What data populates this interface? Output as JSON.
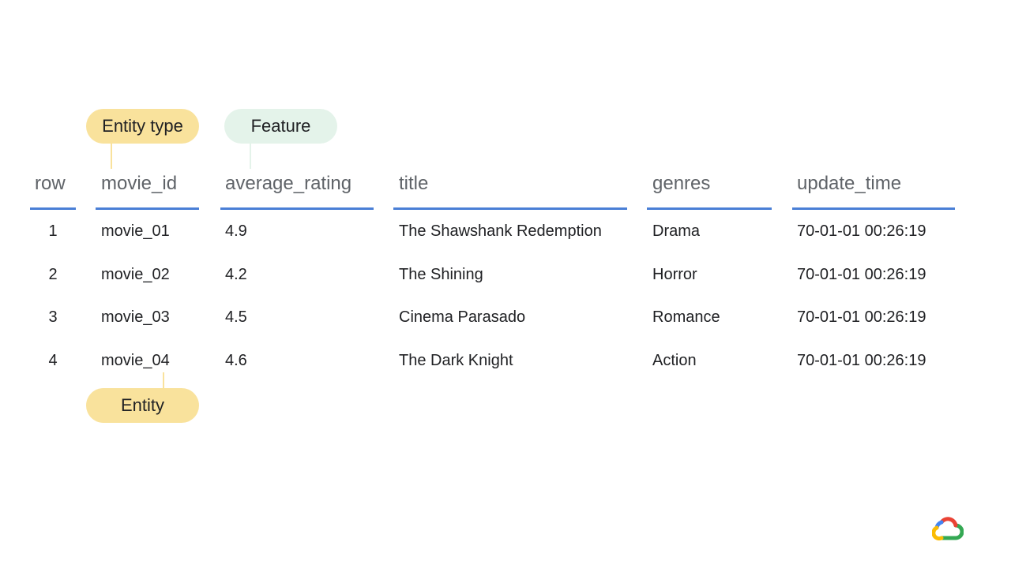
{
  "annotations": {
    "entity_type_label": "Entity type",
    "feature_label": "Feature",
    "entity_label": "Entity"
  },
  "table": {
    "columns": [
      "row",
      "movie_id",
      "average_rating",
      "title",
      "genres",
      "update_time"
    ],
    "rows": [
      [
        "1",
        "movie_01",
        "4.9",
        "The Shawshank Redemption",
        "Drama",
        "70-01-01 00:26:19"
      ],
      [
        "2",
        "movie_02",
        "4.2",
        "The Shining",
        "Horror",
        "70-01-01 00:26:19"
      ],
      [
        "3",
        "movie_03",
        "4.5",
        "Cinema Parasado",
        "Romance",
        "70-01-01 00:26:19"
      ],
      [
        "4",
        "movie_04",
        "4.6",
        "The Dark Knight",
        "Action",
        "70-01-01 00:26:19"
      ]
    ]
  },
  "colors": {
    "entity_pill": "#f9e29c",
    "feature_pill": "#e4f3ea",
    "header_rule": "#4a7fd6",
    "header_text": "#5f6368",
    "cell_text": "#202124"
  },
  "icons": {
    "logo": "google-cloud-logo-icon"
  }
}
